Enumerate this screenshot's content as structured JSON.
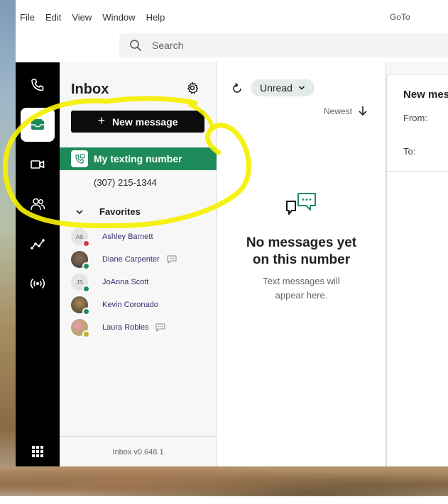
{
  "menubar": {
    "items": [
      "File",
      "Edit",
      "View",
      "Window",
      "Help"
    ],
    "app_title": "GoTo"
  },
  "search": {
    "placeholder": "Search"
  },
  "rail": {
    "icons": [
      "phone-icon",
      "inbox-icon",
      "video-icon",
      "contacts-icon",
      "analytics-icon",
      "broadcast-icon",
      "apps-grid-icon"
    ],
    "active": "inbox-icon"
  },
  "inbox": {
    "title": "Inbox",
    "new_message_label": "New message",
    "texting_label": "My texting number",
    "phone_number": "(307) 215-1344",
    "favorites_label": "Favorites",
    "favorites": [
      {
        "name": "Ashley Barnett",
        "initials": "AB",
        "presence": "dnd",
        "chat": false
      },
      {
        "name": "Diane Carpenter",
        "initials": "",
        "presence": "available",
        "chat": true
      },
      {
        "name": "JoAnna Scott",
        "initials": "JS",
        "presence": "available",
        "chat": false
      },
      {
        "name": "Kevin Coronado",
        "initials": "",
        "presence": "available",
        "chat": false
      },
      {
        "name": "Laura Robles",
        "initials": "",
        "presence": "away",
        "chat": true
      }
    ],
    "footer": "Inbox v0.648.1"
  },
  "messages": {
    "filter_label": "Unread",
    "sort_label": "Newest",
    "empty_title_line1": "No messages yet",
    "empty_title_line2": "on this number",
    "empty_sub_line1": "Text messages will",
    "empty_sub_line2": "appear here."
  },
  "compose": {
    "title": "New mes",
    "from_label": "From:",
    "to_label": "To:"
  },
  "colors": {
    "accent_green": "#1e8a5a",
    "rail_bg": "#000000",
    "annotation_yellow": "#f5f000",
    "redaction_purple": "#6d0fc4"
  }
}
